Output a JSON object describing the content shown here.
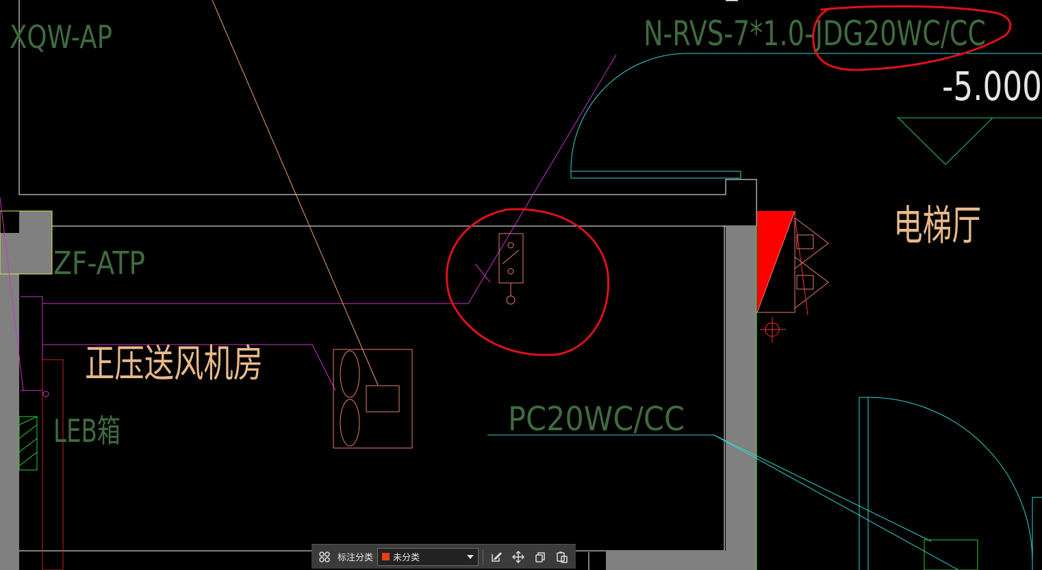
{
  "drawing": {
    "labels": {
      "xqw_ap": "XQW-AP",
      "zf_atp": "ZF-ATP",
      "fan_room": "正压送风机房",
      "leb_box": "LEB箱",
      "cable_spec": "N-RVS-7*1.0-JDG20WC/CC",
      "elevation": "-5.000",
      "elevator_hall": "电梯厅",
      "conduit": "PC20WC/CC"
    },
    "colors": {
      "background": "#000000",
      "wall_fill": "#808080",
      "text_green": "#3f6b3f",
      "text_orange": "#e8b98a",
      "magenta": "#cc33cc",
      "cyan": "#35d6d6",
      "markup_red": "#e0101a",
      "fire_door_red": "#ff0000"
    }
  },
  "toolbar": {
    "category_label": "标注分类",
    "selected_category": "未分类",
    "swatch_color": "#e8400c",
    "icons": [
      "grid-icon",
      "edit-icon",
      "move-icon",
      "copy-icon",
      "paste-icon"
    ]
  }
}
